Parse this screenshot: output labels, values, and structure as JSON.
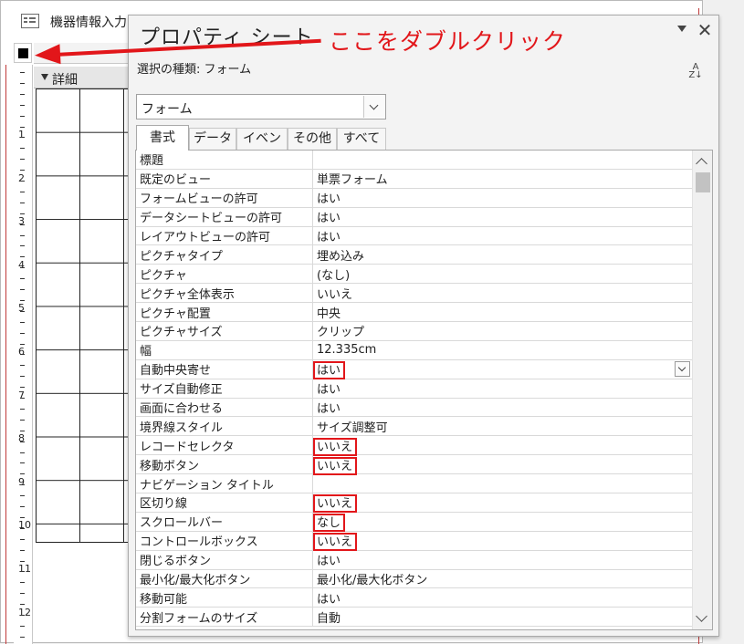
{
  "background_window": {
    "title": "機器情報入力",
    "section_label": "詳細",
    "ruler_numbers": [
      "1",
      "2",
      "3",
      "4",
      "5",
      "6",
      "7",
      "8",
      "9",
      "10",
      "11",
      "12"
    ]
  },
  "property_sheet": {
    "title": "プロパティ シート",
    "selection_type_label": "選択の種類: フォーム",
    "object_combo_value": "フォーム",
    "tabs": [
      {
        "label": "書式",
        "active": true
      },
      {
        "label": "データ",
        "active": false
      },
      {
        "label": "イベント",
        "active": false
      },
      {
        "label": "その他",
        "active": false
      },
      {
        "label": "すべて",
        "active": false
      }
    ],
    "properties": [
      {
        "name": "標題",
        "value": ""
      },
      {
        "name": "既定のビュー",
        "value": "単票フォーム"
      },
      {
        "name": "フォームビューの許可",
        "value": "はい"
      },
      {
        "name": "データシートビューの許可",
        "value": "はい"
      },
      {
        "name": "レイアウトビューの許可",
        "value": "はい"
      },
      {
        "name": "ピクチャタイプ",
        "value": "埋め込み"
      },
      {
        "name": "ピクチャ",
        "value": "(なし)"
      },
      {
        "name": "ピクチャ全体表示",
        "value": "いいえ"
      },
      {
        "name": "ピクチャ配置",
        "value": "中央"
      },
      {
        "name": "ピクチャサイズ",
        "value": "クリップ"
      },
      {
        "name": "幅",
        "value": "12.335cm"
      },
      {
        "name": "自動中央寄せ",
        "value": "はい",
        "highlighted": true,
        "active_dropdown": true
      },
      {
        "name": "サイズ自動修正",
        "value": "はい"
      },
      {
        "name": "画面に合わせる",
        "value": "はい"
      },
      {
        "name": "境界線スタイル",
        "value": "サイズ調整可"
      },
      {
        "name": "レコードセレクタ",
        "value": "いいえ",
        "highlighted": true
      },
      {
        "name": "移動ボタン",
        "value": "いいえ",
        "highlighted": true
      },
      {
        "name": "ナビゲーション タイトル",
        "value": ""
      },
      {
        "name": "区切り線",
        "value": "いいえ",
        "highlighted": true
      },
      {
        "name": "スクロールバー",
        "value": "なし",
        "highlighted": true
      },
      {
        "name": "コントロールボックス",
        "value": "いいえ",
        "highlighted": true
      },
      {
        "name": "閉じるボタン",
        "value": "はい"
      },
      {
        "name": "最小化/最大化ボタン",
        "value": "最小化/最大化ボタン"
      },
      {
        "name": "移動可能",
        "value": "はい"
      },
      {
        "name": "分割フォームのサイズ",
        "value": "自動"
      }
    ]
  },
  "annotation": {
    "text": "ここをダブルクリック",
    "color": "#e2161a"
  }
}
